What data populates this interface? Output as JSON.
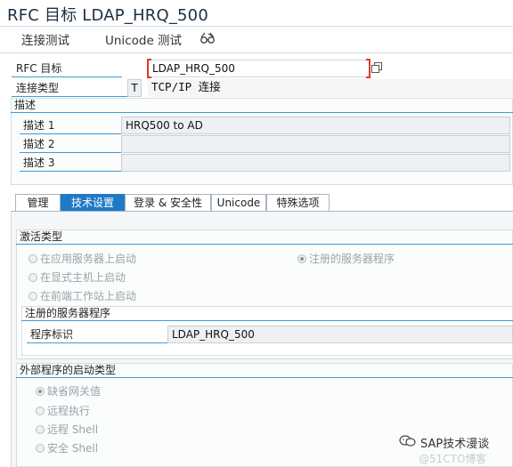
{
  "window": {
    "title": "RFC 目标 LDAP_HRQ_500"
  },
  "toolbar": {
    "conn_test": "连接测试",
    "unicode_test": "Unicode 测试",
    "glasses_icon": "glasses-icon"
  },
  "header": {
    "rfc_dest_label": "RFC 目标",
    "rfc_dest_value": "LDAP_HRQ_500",
    "conn_type_label": "连接类型",
    "conn_type_code": "T",
    "conn_type_text": "TCP/IP 连接"
  },
  "desc": {
    "title": "描述",
    "rows": [
      {
        "label": "描述 1",
        "value": "HRQ500 to AD"
      },
      {
        "label": "描述 2",
        "value": ""
      },
      {
        "label": "描述 3",
        "value": ""
      }
    ]
  },
  "tabs": [
    "管理",
    "技术设置",
    "登录 & 安全性",
    "Unicode",
    "特殊选项"
  ],
  "activation": {
    "title": "激活类型",
    "opt_app_server": "在应用服务器上启动",
    "opt_registered": "注册的服务器程序",
    "opt_explicit_host": "在显式主机上启动",
    "opt_frontend": "在前端工作站上启动",
    "registered_title": "注册的服务器程序",
    "program_id_label": "程序标识",
    "program_id_value": "LDAP_HRQ_500"
  },
  "startup": {
    "title": "外部程序的启动类型",
    "opt_default_gw": "缺省网关值",
    "opt_remote_exec": "远程执行",
    "opt_remote_shell": "远程 Shell",
    "opt_secure_shell": "安全 Shell"
  },
  "watermark": {
    "wechat": "SAP技术漫谈",
    "blog": "@51CTO博客"
  },
  "colors": {
    "accent": "#1f7ac6",
    "rule": "#3e9bd5",
    "field_bg": "#eef1f3"
  }
}
